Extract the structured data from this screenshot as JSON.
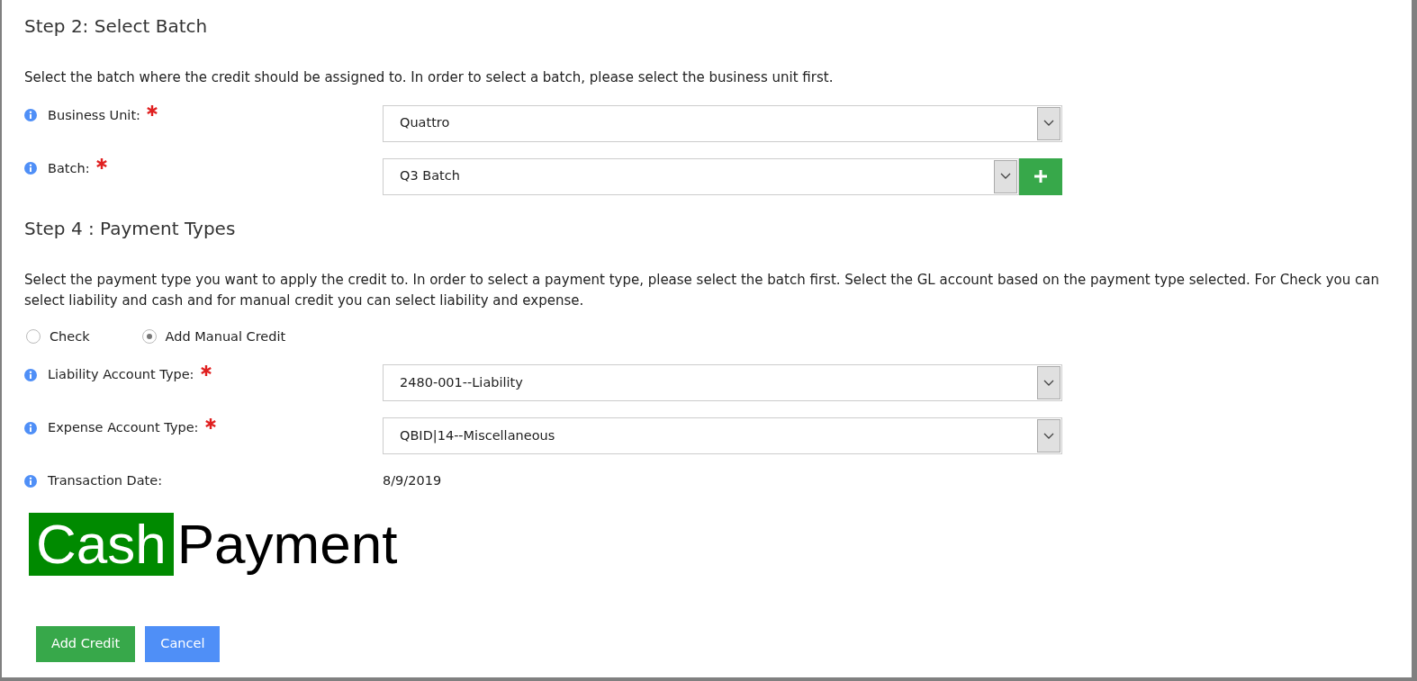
{
  "step2": {
    "title": "Step 2: Select Batch",
    "description": "Select the batch where the credit should be assigned to. In order to select a batch, please select the business unit first.",
    "fields": [
      {
        "kind": "select",
        "label": "Business Unit:",
        "required": true,
        "value": "Quattro",
        "add_button": false
      },
      {
        "kind": "select",
        "label": "Batch:",
        "required": true,
        "value": "Q3 Batch",
        "add_button": true
      }
    ]
  },
  "step4": {
    "title": "Step 4 : Payment Types",
    "description": "Select the payment type you want to apply the credit to. In order to select a payment type, please select the batch first. Select the GL account based on the payment type selected. For Check you can select liability and cash and for manual credit you can select liability and expense.",
    "payment_types": [
      {
        "label": "Check",
        "selected": false
      },
      {
        "label": "Add Manual Credit",
        "selected": true
      }
    ],
    "fields": [
      {
        "kind": "select",
        "label": "Liability Account Type:",
        "required": true,
        "value": "2480-001--Liability",
        "add_button": false
      },
      {
        "kind": "select",
        "label": "Expense Account Type:",
        "required": true,
        "value": "QBID|14--Miscellaneous",
        "add_button": false
      },
      {
        "kind": "text",
        "label": "Transaction Date:",
        "required": false,
        "value": "8/9/2019"
      }
    ]
  },
  "logo": {
    "highlighted": "Cash",
    "rest": "Payment"
  },
  "buttons": [
    {
      "kind": "primary",
      "label": "Add Credit"
    },
    {
      "kind": "secondary",
      "label": "Cancel"
    }
  ]
}
